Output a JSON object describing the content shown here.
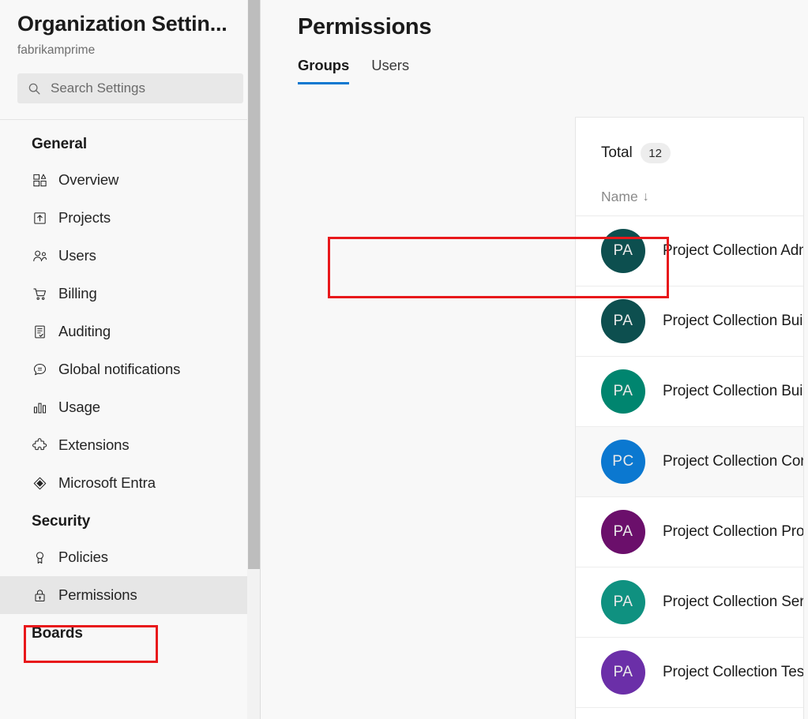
{
  "sidebar": {
    "org_title": "Organization Settin...",
    "org_subtitle": "fabrikamprime",
    "search": {
      "placeholder": "Search Settings",
      "value": "",
      "icon": "search-icon"
    },
    "sections": [
      {
        "title": "General",
        "items": [
          {
            "label": "Overview",
            "icon": "overview-icon"
          },
          {
            "label": "Projects",
            "icon": "projects-icon"
          },
          {
            "label": "Users",
            "icon": "users-icon"
          },
          {
            "label": "Billing",
            "icon": "billing-cart-icon"
          },
          {
            "label": "Auditing",
            "icon": "auditing-icon"
          },
          {
            "label": "Global notifications",
            "icon": "notifications-icon"
          },
          {
            "label": "Usage",
            "icon": "usage-chart-icon"
          },
          {
            "label": "Extensions",
            "icon": "extensions-icon"
          },
          {
            "label": "Microsoft Entra",
            "icon": "microsoft-entra-icon"
          }
        ]
      },
      {
        "title": "Security",
        "items": [
          {
            "label": "Policies",
            "icon": "policies-ribbon-icon"
          },
          {
            "label": "Permissions",
            "icon": "permissions-lock-icon",
            "selected": true,
            "highlighted": true
          }
        ]
      },
      {
        "title": "Boards",
        "items": []
      }
    ]
  },
  "main": {
    "page_title": "Permissions",
    "tabs": [
      {
        "label": "Groups",
        "active": true
      },
      {
        "label": "Users",
        "active": false
      }
    ],
    "total": {
      "label": "Total",
      "count": "12"
    },
    "table": {
      "columns": [
        {
          "label": "Name",
          "sort": "↓"
        }
      ],
      "rows": [
        {
          "initials": "PA",
          "color": "#0d4f4f",
          "name": "Project Collection Administrators",
          "highlighted": true
        },
        {
          "initials": "PA",
          "color": "#0d4f4f",
          "name": "Project Collection Build Administrators"
        },
        {
          "initials": "PA",
          "color": "#00856f",
          "name": "Project Collection Build Service Accounts"
        },
        {
          "initials": "PC",
          "color": "#0b78d0",
          "name": "Project Collection Contributors"
        },
        {
          "initials": "PA",
          "color": "#6b0f6b",
          "name": "Project Collection Proxy Service Accounts"
        },
        {
          "initials": "PA",
          "color": "#0f9180",
          "name": "Project Collection Service Accounts"
        },
        {
          "initials": "PA",
          "color": "#6b2fa8",
          "name": "Project Collection Test Service Accounts"
        }
      ]
    }
  },
  "theme": {
    "accent_blue": "#0b78d0",
    "callout_red": "#e8181b",
    "sidebar_bg": "#f8f8f8",
    "selected_bg": "#e6e6e6"
  }
}
